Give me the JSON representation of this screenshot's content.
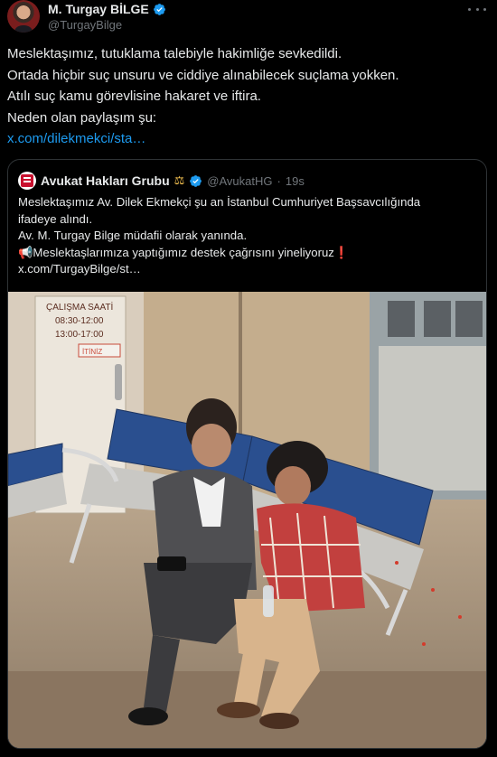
{
  "tweet": {
    "author_name": "M. Turgay BİLGE",
    "author_handle": "@TurgayBilge",
    "lines": [
      "Meslektaşımız, tutuklama talebiyle hakimliğe sevkedildi.",
      "Ortada hiçbir suç unsuru ve ciddiye alınabilecek suçlama yokken.",
      "Atılı suç kamu görevlisine hakaret ve iftira.",
      "Neden olan paylaşım şu:"
    ],
    "link": "x.com/dilekmekci/sta…"
  },
  "quote": {
    "author_name": "Avukat Hakları Grubu",
    "author_handle": "@AvukatHG",
    "separator": "·",
    "time": "19s",
    "lines": [
      "Meslektaşımız Av. Dilek Ekmekçi şu an İstanbul Cumhuriyet Başsavcılığında",
      "ifadeye alındı.",
      "Av. M. Turgay Bilge müdafii olarak yanında.",
      "📢Meslektaşlarımıza yaptığımız destek çağrısını yineliyoruz❗",
      "x.com/TurgayBilge/st…"
    ]
  },
  "photo": {
    "sign_title": "ÇALIŞMA SAATİ",
    "sign_hours_1": "08:30-12:00",
    "sign_hours_2": "13:00-17:00",
    "door_label": "İTİNİZ"
  },
  "colors": {
    "background": "#000000",
    "text": "#e7e9ea",
    "muted": "#71767b",
    "link": "#1d9bf0",
    "border": "#2f3336",
    "verified": "#1d9bf0"
  },
  "icons": [
    "verified-badge-icon",
    "more-options-icon",
    "balance-scale-icon",
    "megaphone-icon",
    "exclamation-icon"
  ]
}
